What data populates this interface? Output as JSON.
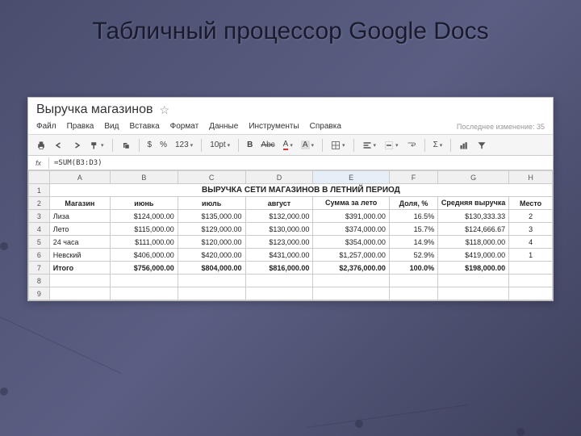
{
  "slide_title": "Табличный процессор Google Docs",
  "doc": {
    "title": "Выручка магазинов"
  },
  "menu": {
    "file": "Файл",
    "edit": "Правка",
    "view": "Вид",
    "insert": "Вставка",
    "format": "Формат",
    "data": "Данные",
    "tools": "Инструменты",
    "help": "Справка",
    "last_modified": "Последнее изменение: 35"
  },
  "toolbar": {
    "currency": "$",
    "percent": "%",
    "numfmt": "123",
    "fontsize": "10pt",
    "bold": "B",
    "strike": "Abc",
    "textA": "A",
    "fillA": "A",
    "sigma": "Σ"
  },
  "formula_bar": {
    "fx": "fx",
    "value": "=SUM(B3:D3)"
  },
  "cols": [
    "A",
    "B",
    "C",
    "D",
    "E",
    "F",
    "G",
    "H"
  ],
  "sheet": {
    "title_row": "ВЫРУЧКА СЕТИ МАГАЗИНОВ В ЛЕТНИЙ ПЕРИОД",
    "headers": {
      "store": "Магазин",
      "jun": "июнь",
      "jul": "июль",
      "aug": "август",
      "sum": "Сумма за лето",
      "share": "Доля, %",
      "avg": "Средняя выручка",
      "place": "Место"
    },
    "rows": [
      {
        "n": "3",
        "store": "Лиза",
        "jun": "$124,000.00",
        "jul": "$135,000.00",
        "aug": "$132,000.00",
        "sum": "$391,000.00",
        "share": "16.5%",
        "avg": "$130,333.33",
        "place": "2"
      },
      {
        "n": "4",
        "store": "Лето",
        "jun": "$115,000.00",
        "jul": "$129,000.00",
        "aug": "$130,000.00",
        "sum": "$374,000.00",
        "share": "15.7%",
        "avg": "$124,666.67",
        "place": "3"
      },
      {
        "n": "5",
        "store": "24 часа",
        "jun": "$111,000.00",
        "jul": "$120,000.00",
        "aug": "$123,000.00",
        "sum": "$354,000.00",
        "share": "14.9%",
        "avg": "$118,000.00",
        "place": "4"
      },
      {
        "n": "6",
        "store": "Невский",
        "jun": "$406,000.00",
        "jul": "$420,000.00",
        "aug": "$431,000.00",
        "sum": "$1,257,000.00",
        "share": "52.9%",
        "avg": "$419,000.00",
        "place": "1"
      }
    ],
    "total": {
      "n": "7",
      "store": "Итого",
      "jun": "$756,000.00",
      "jul": "$804,000.00",
      "aug": "$816,000.00",
      "sum": "$2,376,000.00",
      "share": "100.0%",
      "avg": "$198,000.00",
      "place": ""
    },
    "empty_rows": [
      "8",
      "9"
    ]
  }
}
